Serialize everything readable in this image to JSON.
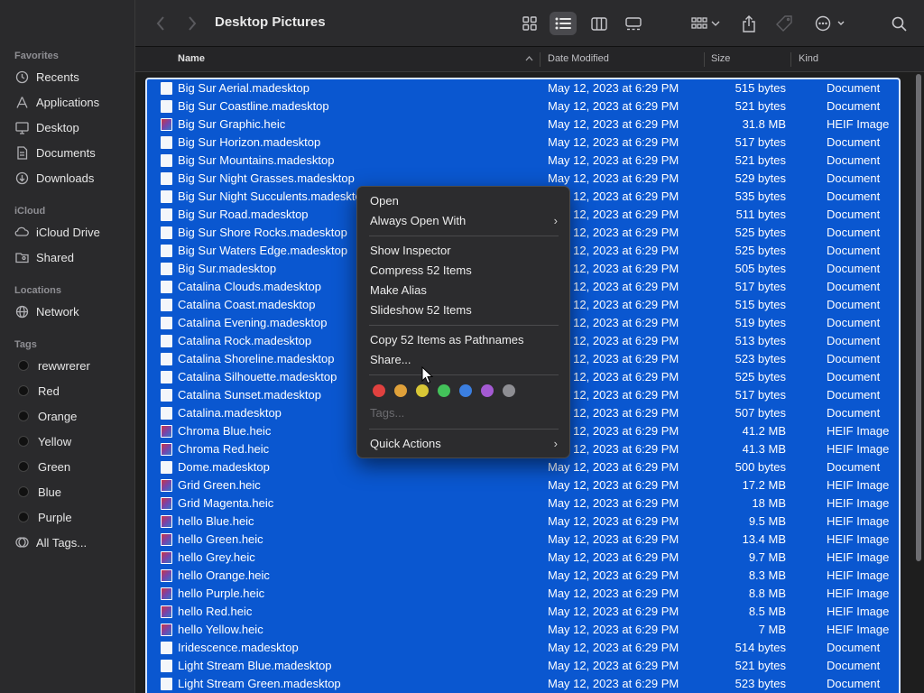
{
  "window": {
    "title": "Desktop Pictures"
  },
  "sidebar": {
    "favorites_label": "Favorites",
    "favorites": [
      {
        "label": "Recents",
        "icon": "clock-icon"
      },
      {
        "label": "Applications",
        "icon": "applications-icon"
      },
      {
        "label": "Desktop",
        "icon": "desktop-icon"
      },
      {
        "label": "Documents",
        "icon": "document-icon"
      },
      {
        "label": "Downloads",
        "icon": "download-icon"
      }
    ],
    "icloud_label": "iCloud",
    "icloud": [
      {
        "label": "iCloud Drive",
        "icon": "cloud-icon"
      },
      {
        "label": "Shared",
        "icon": "shared-folder-icon"
      }
    ],
    "locations_label": "Locations",
    "locations": [
      {
        "label": "Network",
        "icon": "globe-icon"
      }
    ],
    "tags_label": "Tags",
    "tags": [
      "rewwrerer",
      "Red",
      "Orange",
      "Yellow",
      "Green",
      "Blue",
      "Purple"
    ],
    "all_tags": "All Tags..."
  },
  "columns": {
    "name": "Name",
    "date": "Date Modified",
    "size": "Size",
    "kind": "Kind"
  },
  "files": [
    [
      "Big Sur Aerial.madesktop",
      "May 12, 2023 at 6:29 PM",
      "515 bytes",
      "Document"
    ],
    [
      "Big Sur Coastline.madesktop",
      "May 12, 2023 at 6:29 PM",
      "521 bytes",
      "Document"
    ],
    [
      "Big Sur Graphic.heic",
      "May 12, 2023 at 6:29 PM",
      "31.8 MB",
      "HEIF Image"
    ],
    [
      "Big Sur Horizon.madesktop",
      "May 12, 2023 at 6:29 PM",
      "517 bytes",
      "Document"
    ],
    [
      "Big Sur Mountains.madesktop",
      "May 12, 2023 at 6:29 PM",
      "521 bytes",
      "Document"
    ],
    [
      "Big Sur Night Grasses.madesktop",
      "May 12, 2023 at 6:29 PM",
      "529 bytes",
      "Document"
    ],
    [
      "Big Sur Night Succulents.madesktop",
      "May 12, 2023 at 6:29 PM",
      "535 bytes",
      "Document"
    ],
    [
      "Big Sur Road.madesktop",
      "May 12, 2023 at 6:29 PM",
      "511 bytes",
      "Document"
    ],
    [
      "Big Sur Shore Rocks.madesktop",
      "May 12, 2023 at 6:29 PM",
      "525 bytes",
      "Document"
    ],
    [
      "Big Sur Waters Edge.madesktop",
      "May 12, 2023 at 6:29 PM",
      "525 bytes",
      "Document"
    ],
    [
      "Big Sur.madesktop",
      "May 12, 2023 at 6:29 PM",
      "505 bytes",
      "Document"
    ],
    [
      "Catalina Clouds.madesktop",
      "May 12, 2023 at 6:29 PM",
      "517 bytes",
      "Document"
    ],
    [
      "Catalina Coast.madesktop",
      "May 12, 2023 at 6:29 PM",
      "515 bytes",
      "Document"
    ],
    [
      "Catalina Evening.madesktop",
      "May 12, 2023 at 6:29 PM",
      "519 bytes",
      "Document"
    ],
    [
      "Catalina Rock.madesktop",
      "May 12, 2023 at 6:29 PM",
      "513 bytes",
      "Document"
    ],
    [
      "Catalina Shoreline.madesktop",
      "May 12, 2023 at 6:29 PM",
      "523 bytes",
      "Document"
    ],
    [
      "Catalina Silhouette.madesktop",
      "May 12, 2023 at 6:29 PM",
      "525 bytes",
      "Document"
    ],
    [
      "Catalina Sunset.madesktop",
      "May 12, 2023 at 6:29 PM",
      "517 bytes",
      "Document"
    ],
    [
      "Catalina.madesktop",
      "May 12, 2023 at 6:29 PM",
      "507 bytes",
      "Document"
    ],
    [
      "Chroma Blue.heic",
      "May 12, 2023 at 6:29 PM",
      "41.2 MB",
      "HEIF Image"
    ],
    [
      "Chroma Red.heic",
      "May 12, 2023 at 6:29 PM",
      "41.3 MB",
      "HEIF Image"
    ],
    [
      "Dome.madesktop",
      "May 12, 2023 at 6:29 PM",
      "500 bytes",
      "Document"
    ],
    [
      "Grid Green.heic",
      "May 12, 2023 at 6:29 PM",
      "17.2 MB",
      "HEIF Image"
    ],
    [
      "Grid Magenta.heic",
      "May 12, 2023 at 6:29 PM",
      "18 MB",
      "HEIF Image"
    ],
    [
      "hello Blue.heic",
      "May 12, 2023 at 6:29 PM",
      "9.5 MB",
      "HEIF Image"
    ],
    [
      "hello Green.heic",
      "May 12, 2023 at 6:29 PM",
      "13.4 MB",
      "HEIF Image"
    ],
    [
      "hello Grey.heic",
      "May 12, 2023 at 6:29 PM",
      "9.7 MB",
      "HEIF Image"
    ],
    [
      "hello Orange.heic",
      "May 12, 2023 at 6:29 PM",
      "8.3 MB",
      "HEIF Image"
    ],
    [
      "hello Purple.heic",
      "May 12, 2023 at 6:29 PM",
      "8.8 MB",
      "HEIF Image"
    ],
    [
      "hello Red.heic",
      "May 12, 2023 at 6:29 PM",
      "8.5 MB",
      "HEIF Image"
    ],
    [
      "hello Yellow.heic",
      "May 12, 2023 at 6:29 PM",
      "7 MB",
      "HEIF Image"
    ],
    [
      "Iridescence.madesktop",
      "May 12, 2023 at 6:29 PM",
      "514 bytes",
      "Document"
    ],
    [
      "Light Stream Blue.madesktop",
      "May 12, 2023 at 6:29 PM",
      "521 bytes",
      "Document"
    ],
    [
      "Light Stream Green.madesktop",
      "May 12, 2023 at 6:29 PM",
      "523 bytes",
      "Document"
    ]
  ],
  "context_menu": {
    "open": "Open",
    "always_open_with": "Always Open With",
    "show_inspector": "Show Inspector",
    "compress": "Compress 52 Items",
    "make_alias": "Make Alias",
    "slideshow": "Slideshow 52 Items",
    "copy_pathnames": "Copy 52 Items as Pathnames",
    "share": "Share...",
    "tag_colors": [
      "#e0413f",
      "#e0a13a",
      "#d9c736",
      "#43c25a",
      "#3b7fe0",
      "#a45ad3",
      "#8e8e93"
    ],
    "tags": "Tags...",
    "quick_actions": "Quick Actions"
  },
  "colors": {
    "selection": "#0a57d0",
    "selection_border": "#d8e6ff"
  }
}
